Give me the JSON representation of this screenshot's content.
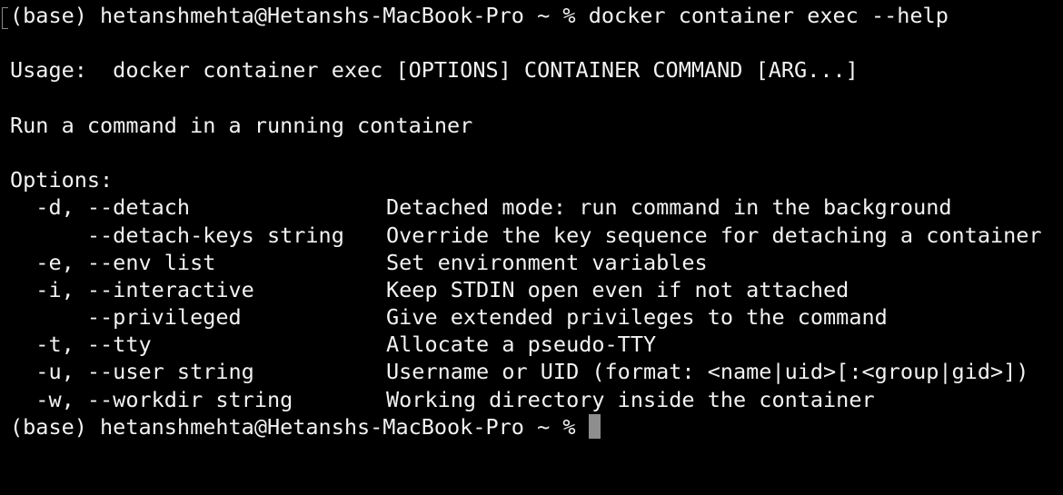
{
  "prompt": "(base) hetanshmehta@Hetanshs-MacBook-Pro ~ %",
  "command": "docker container exec --help",
  "usage_line": "Usage:  docker container exec [OPTIONS] CONTAINER COMMAND [ARG...]",
  "description_line": "Run a command in a running container",
  "options_header": "Options:",
  "options": [
    {
      "flag": "  -d, --detach",
      "desc": "Detached mode: run command in the background"
    },
    {
      "flag": "      --detach-keys string",
      "desc": "Override the key sequence for detaching a container"
    },
    {
      "flag": "  -e, --env list",
      "desc": "Set environment variables"
    },
    {
      "flag": "  -i, --interactive",
      "desc": "Keep STDIN open even if not attached"
    },
    {
      "flag": "      --privileged",
      "desc": "Give extended privileges to the command"
    },
    {
      "flag": "  -t, --tty",
      "desc": "Allocate a pseudo-TTY"
    },
    {
      "flag": "  -u, --user string",
      "desc": "Username or UID (format: <name|uid>[:<group|gid>])"
    },
    {
      "flag": "  -w, --workdir string",
      "desc": "Working directory inside the container"
    }
  ],
  "final_prompt": "(base) hetanshmehta@Hetanshs-MacBook-Pro ~ %",
  "colors": {
    "background": "#000000",
    "text": "#f2f2f2",
    "cursor": "#8e8e8e"
  }
}
